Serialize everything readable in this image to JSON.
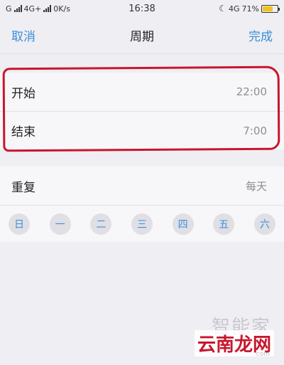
{
  "status_bar": {
    "carrier_left": "G",
    "network": "4G+",
    "speed": "0K/s",
    "time": "16:38",
    "network_right": "4G",
    "battery": "71%",
    "battery_level": 0.71
  },
  "nav": {
    "cancel": "取消",
    "title": "周期",
    "done": "完成"
  },
  "time_settings": {
    "start_label": "开始",
    "start_value": "22:00",
    "end_label": "结束",
    "end_value": "7:00"
  },
  "repeat": {
    "label": "重复",
    "value": "每天",
    "days": [
      "日",
      "一",
      "二",
      "三",
      "四",
      "五",
      "六"
    ]
  },
  "watermark": {
    "top": "智能家",
    "bottom": "云南龙网",
    "domain": "com"
  },
  "colors": {
    "accent": "#3a8fd9",
    "highlight": "#c8162c",
    "battery": "#f0c419"
  }
}
